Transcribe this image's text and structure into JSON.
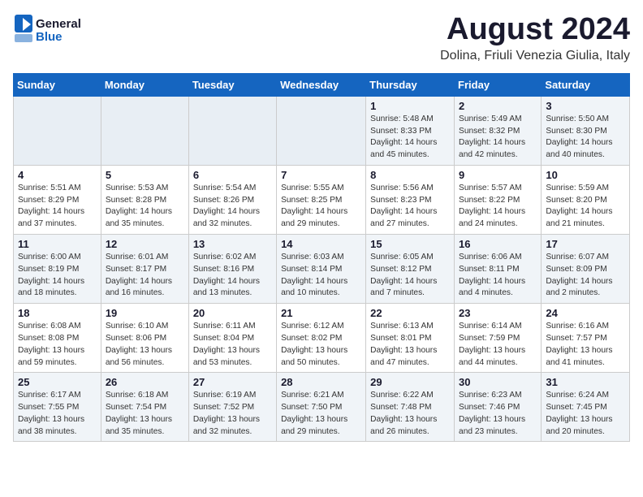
{
  "logo": {
    "text_general": "General",
    "text_blue": "Blue"
  },
  "title": "August 2024",
  "subtitle": "Dolina, Friuli Venezia Giulia, Italy",
  "weekdays": [
    "Sunday",
    "Monday",
    "Tuesday",
    "Wednesday",
    "Thursday",
    "Friday",
    "Saturday"
  ],
  "weeks": [
    [
      {
        "day": "",
        "info": ""
      },
      {
        "day": "",
        "info": ""
      },
      {
        "day": "",
        "info": ""
      },
      {
        "day": "",
        "info": ""
      },
      {
        "day": "1",
        "info": "Sunrise: 5:48 AM\nSunset: 8:33 PM\nDaylight: 14 hours\nand 45 minutes."
      },
      {
        "day": "2",
        "info": "Sunrise: 5:49 AM\nSunset: 8:32 PM\nDaylight: 14 hours\nand 42 minutes."
      },
      {
        "day": "3",
        "info": "Sunrise: 5:50 AM\nSunset: 8:30 PM\nDaylight: 14 hours\nand 40 minutes."
      }
    ],
    [
      {
        "day": "4",
        "info": "Sunrise: 5:51 AM\nSunset: 8:29 PM\nDaylight: 14 hours\nand 37 minutes."
      },
      {
        "day": "5",
        "info": "Sunrise: 5:53 AM\nSunset: 8:28 PM\nDaylight: 14 hours\nand 35 minutes."
      },
      {
        "day": "6",
        "info": "Sunrise: 5:54 AM\nSunset: 8:26 PM\nDaylight: 14 hours\nand 32 minutes."
      },
      {
        "day": "7",
        "info": "Sunrise: 5:55 AM\nSunset: 8:25 PM\nDaylight: 14 hours\nand 29 minutes."
      },
      {
        "day": "8",
        "info": "Sunrise: 5:56 AM\nSunset: 8:23 PM\nDaylight: 14 hours\nand 27 minutes."
      },
      {
        "day": "9",
        "info": "Sunrise: 5:57 AM\nSunset: 8:22 PM\nDaylight: 14 hours\nand 24 minutes."
      },
      {
        "day": "10",
        "info": "Sunrise: 5:59 AM\nSunset: 8:20 PM\nDaylight: 14 hours\nand 21 minutes."
      }
    ],
    [
      {
        "day": "11",
        "info": "Sunrise: 6:00 AM\nSunset: 8:19 PM\nDaylight: 14 hours\nand 18 minutes."
      },
      {
        "day": "12",
        "info": "Sunrise: 6:01 AM\nSunset: 8:17 PM\nDaylight: 14 hours\nand 16 minutes."
      },
      {
        "day": "13",
        "info": "Sunrise: 6:02 AM\nSunset: 8:16 PM\nDaylight: 14 hours\nand 13 minutes."
      },
      {
        "day": "14",
        "info": "Sunrise: 6:03 AM\nSunset: 8:14 PM\nDaylight: 14 hours\nand 10 minutes."
      },
      {
        "day": "15",
        "info": "Sunrise: 6:05 AM\nSunset: 8:12 PM\nDaylight: 14 hours\nand 7 minutes."
      },
      {
        "day": "16",
        "info": "Sunrise: 6:06 AM\nSunset: 8:11 PM\nDaylight: 14 hours\nand 4 minutes."
      },
      {
        "day": "17",
        "info": "Sunrise: 6:07 AM\nSunset: 8:09 PM\nDaylight: 14 hours\nand 2 minutes."
      }
    ],
    [
      {
        "day": "18",
        "info": "Sunrise: 6:08 AM\nSunset: 8:08 PM\nDaylight: 13 hours\nand 59 minutes."
      },
      {
        "day": "19",
        "info": "Sunrise: 6:10 AM\nSunset: 8:06 PM\nDaylight: 13 hours\nand 56 minutes."
      },
      {
        "day": "20",
        "info": "Sunrise: 6:11 AM\nSunset: 8:04 PM\nDaylight: 13 hours\nand 53 minutes."
      },
      {
        "day": "21",
        "info": "Sunrise: 6:12 AM\nSunset: 8:02 PM\nDaylight: 13 hours\nand 50 minutes."
      },
      {
        "day": "22",
        "info": "Sunrise: 6:13 AM\nSunset: 8:01 PM\nDaylight: 13 hours\nand 47 minutes."
      },
      {
        "day": "23",
        "info": "Sunrise: 6:14 AM\nSunset: 7:59 PM\nDaylight: 13 hours\nand 44 minutes."
      },
      {
        "day": "24",
        "info": "Sunrise: 6:16 AM\nSunset: 7:57 PM\nDaylight: 13 hours\nand 41 minutes."
      }
    ],
    [
      {
        "day": "25",
        "info": "Sunrise: 6:17 AM\nSunset: 7:55 PM\nDaylight: 13 hours\nand 38 minutes."
      },
      {
        "day": "26",
        "info": "Sunrise: 6:18 AM\nSunset: 7:54 PM\nDaylight: 13 hours\nand 35 minutes."
      },
      {
        "day": "27",
        "info": "Sunrise: 6:19 AM\nSunset: 7:52 PM\nDaylight: 13 hours\nand 32 minutes."
      },
      {
        "day": "28",
        "info": "Sunrise: 6:21 AM\nSunset: 7:50 PM\nDaylight: 13 hours\nand 29 minutes."
      },
      {
        "day": "29",
        "info": "Sunrise: 6:22 AM\nSunset: 7:48 PM\nDaylight: 13 hours\nand 26 minutes."
      },
      {
        "day": "30",
        "info": "Sunrise: 6:23 AM\nSunset: 7:46 PM\nDaylight: 13 hours\nand 23 minutes."
      },
      {
        "day": "31",
        "info": "Sunrise: 6:24 AM\nSunset: 7:45 PM\nDaylight: 13 hours\nand 20 minutes."
      }
    ]
  ]
}
